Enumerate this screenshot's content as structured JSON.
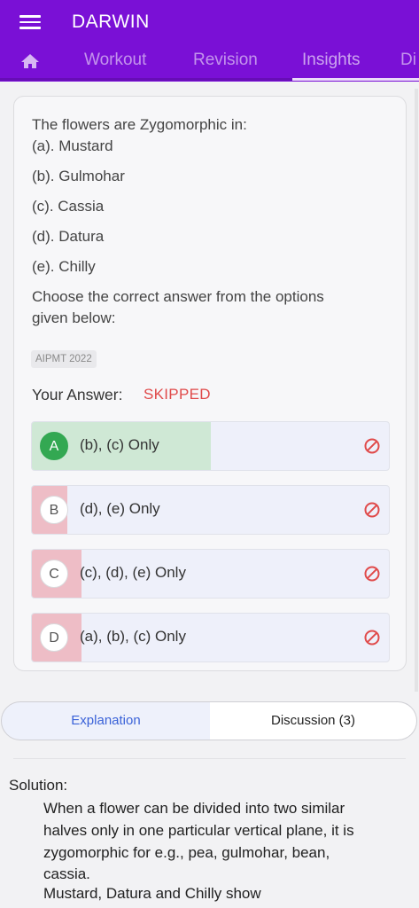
{
  "header": {
    "title": "DARWIN",
    "tabs": [
      {
        "label": "Workout"
      },
      {
        "label": "Revision"
      },
      {
        "label": "Insights"
      },
      {
        "label": "Di"
      }
    ]
  },
  "question": {
    "lines": [
      "The flowers are Zygomorphic in:",
      "(a). Mustard",
      "(b). Gulmohar",
      "(c). Cassia",
      "(d). Datura",
      "(e). Chilly",
      "Choose the correct answer from the options",
      "given below:"
    ],
    "tag": "AIPMT 2022",
    "your_answer_label": "Your Answer:",
    "your_answer_value": "SKIPPED"
  },
  "options": [
    {
      "letter": "A",
      "text": "(b), (c) Only",
      "correct": true,
      "percent": 50
    },
    {
      "letter": "B",
      "text": "(d), (e) Only",
      "correct": false,
      "percent": 10
    },
    {
      "letter": "C",
      "text": "(c), (d), (e) Only",
      "correct": false,
      "percent": 14
    },
    {
      "letter": "D",
      "text": "(a), (b), (c) Only",
      "correct": false,
      "percent": 14
    }
  ],
  "bottom_tabs": {
    "explanation": "Explanation",
    "discussion": "Discussion (3)"
  },
  "solution": {
    "label": "Solution:",
    "lines": [
      "When a flower can be divided into two similar",
      "halves only in one particular vertical plane, it is",
      "zygomorphic for e.g., pea, gulmohar, bean,",
      "cassia.",
      "Mustard, Datura and Chilly show"
    ]
  },
  "colors": {
    "brand": "#7a10d6",
    "correct_fill": "#cfe8d5",
    "wrong_fill": "#eebdc6",
    "accent_blue": "#3a62d8",
    "skipped_red": "#e04a4a"
  },
  "icons": {
    "menu": "menu-icon",
    "home": "home-icon",
    "blocked": "block-icon"
  }
}
